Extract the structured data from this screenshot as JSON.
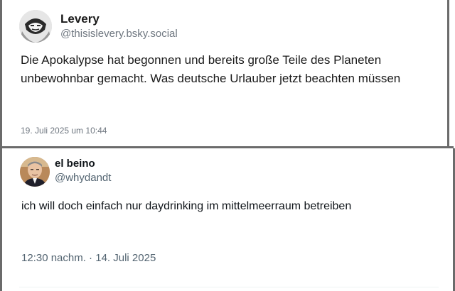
{
  "post1": {
    "author_name": "Levery",
    "author_handle": "@thisislevery.bsky.social",
    "avatar_icon": "profile-avatar",
    "text": "Die Apokalypse hat begonnen und bereits große Teile des Planeten unbewohnbar gemacht. Was deutsche Urlauber jetzt beachten müssen",
    "date": "19. Juli 2025 um 10:44"
  },
  "post2": {
    "author_name": "el beino",
    "author_handle": "@whydandt",
    "avatar_icon": "profile-avatar",
    "text": "ich will doch einfach nur daydrinking im mittelmeerraum betreiben",
    "date": "12:30 nachm. · 14. Juli 2025"
  }
}
